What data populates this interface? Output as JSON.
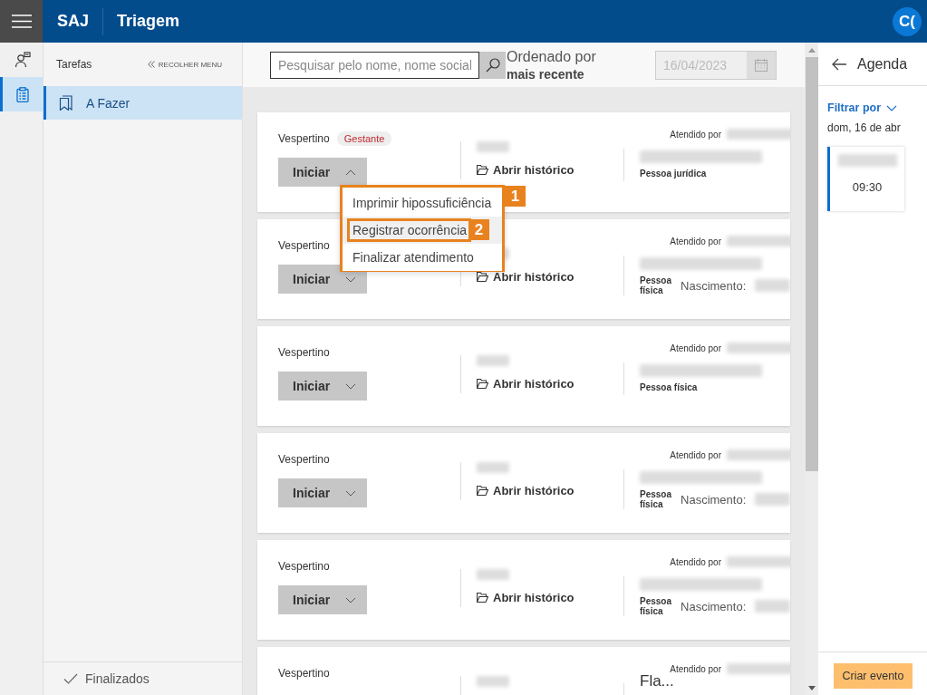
{
  "header": {
    "brand": "SAJ",
    "title": "Triagem",
    "avatar": "C("
  },
  "rail": [
    {
      "kind": "person",
      "selected": false
    },
    {
      "kind": "clipboard",
      "selected": true
    }
  ],
  "sidebar": {
    "title": "Tarefas",
    "collapse": "RECOLHER MENU",
    "items": [
      {
        "label": "A Fazer",
        "selected": true
      }
    ],
    "footer": "Finalizados"
  },
  "toolbar": {
    "search_placeholder": "Pesquisar pelo nome, nome social",
    "sort_label": "Ordenado por",
    "sort_value": "mais recente",
    "date": "16/04/2023",
    "date_disabled": true
  },
  "cards": [
    {
      "shift": "Vespertino",
      "tag": "Gestante",
      "start": "Iniciar",
      "expanded": true,
      "history": "Abrir histórico",
      "attended_label": "Atendido por",
      "person_type": "Pessoa jurídica"
    },
    {
      "shift": "Vespertino",
      "start": "Iniciar",
      "expanded": false,
      "history": "Abrir histórico",
      "attended_label": "Atendido por",
      "person_type": "Pessoa física",
      "birth_label": "Nascimento:"
    },
    {
      "shift": "Vespertino",
      "start": "Iniciar",
      "expanded": false,
      "history": "Abrir histórico",
      "attended_label": "Atendido por",
      "person_type": "Pessoa física"
    },
    {
      "shift": "Vespertino",
      "start": "Iniciar",
      "expanded": false,
      "history": "Abrir histórico",
      "attended_label": "Atendido por",
      "person_type": "Pessoa física",
      "birth_label": "Nascimento:"
    },
    {
      "shift": "Vespertino",
      "start": "Iniciar",
      "expanded": false,
      "history": "Abrir histórico",
      "attended_label": "Atendido por",
      "person_type": "Pessoa física",
      "birth_label": "Nascimento:"
    },
    {
      "shift": "Vespertino",
      "attended_label": "Atendido por",
      "title": "Fla..."
    }
  ],
  "menu": {
    "step": "1",
    "items": [
      {
        "label": "Imprimir hipossuficiência",
        "hovered": false
      },
      {
        "label": "Registrar ocorrência",
        "hovered": true,
        "step": "2"
      },
      {
        "label": "Finalizar atendimento",
        "hovered": false
      }
    ]
  },
  "agenda": {
    "title": "Agenda",
    "filter": "Filtrar por",
    "date": "dom, 16 de abr",
    "events": [
      {
        "time": "09:30"
      }
    ],
    "button": "Criar evento"
  }
}
